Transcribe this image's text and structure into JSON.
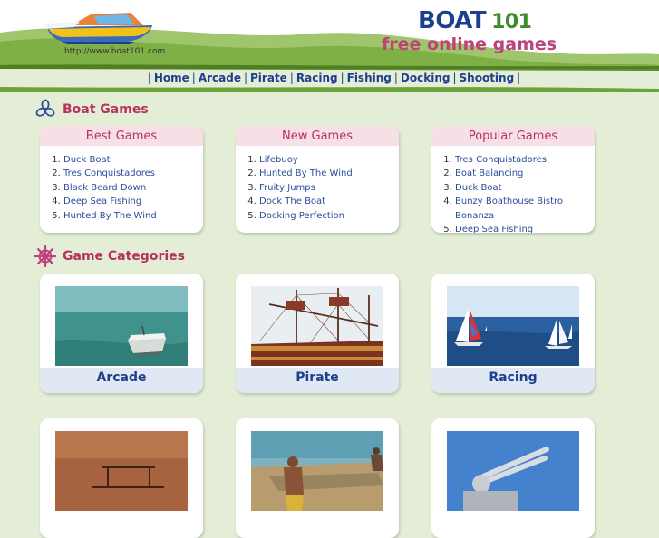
{
  "header": {
    "site_url": "http://www.boat101.com",
    "brand_word1": "BOAT",
    "brand_word2": "101",
    "tagline": "free online games"
  },
  "nav": {
    "items": [
      "Home",
      "Arcade",
      "Pirate",
      "Racing",
      "Fishing",
      "Docking",
      "Shooting"
    ]
  },
  "sections": {
    "boat_games": "Boat Games",
    "game_categories": "Game Categories"
  },
  "lists": {
    "best": {
      "title": "Best Games",
      "items": [
        "Duck Boat",
        "Tres Conquistadores",
        "Black Beard Down",
        "Deep Sea Fishing",
        "Hunted By The Wind"
      ]
    },
    "new": {
      "title": "New Games",
      "items": [
        "Lifebuoy",
        "Hunted By The Wind",
        "Fruity Jumps",
        "Dock The Boat",
        "Docking Perfection"
      ]
    },
    "popular": {
      "title": "Popular Games",
      "items": [
        "Tres Conquistadores",
        "Boat Balancing",
        "Duck Boat",
        "Bunzy Boathouse Bistro Bonanza",
        "Deep Sea Fishing"
      ]
    }
  },
  "categories": {
    "arcade": "Arcade",
    "pirate": "Pirate",
    "racing": "Racing"
  },
  "colors": {
    "accent_pink": "#b5335c",
    "link_blue": "#2b4d9a",
    "nav_blue": "#1d3f8f",
    "page_green": "#e4edd6",
    "header_green": "#6ea23c"
  }
}
